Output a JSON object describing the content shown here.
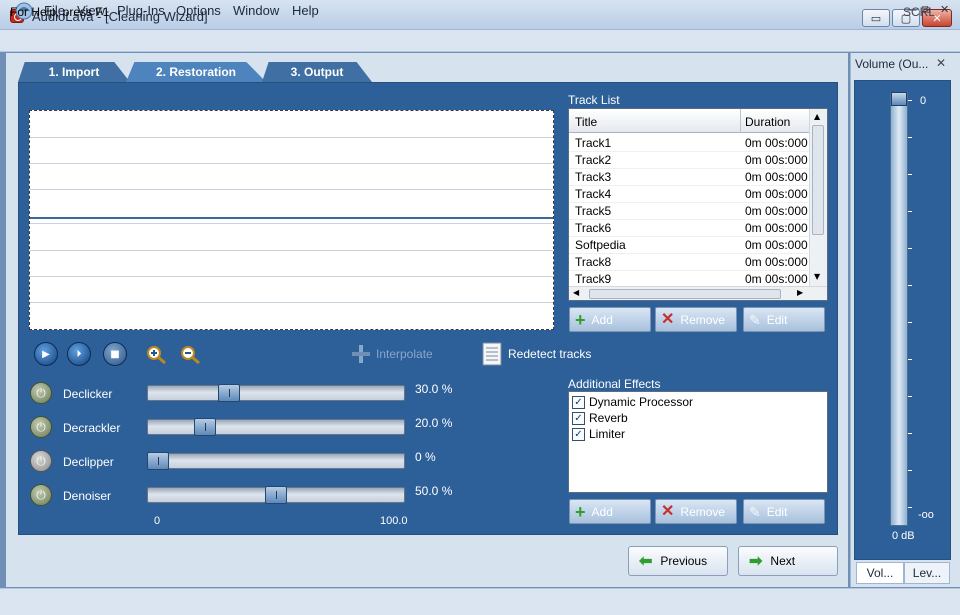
{
  "app": {
    "title": "AudioLava - [Cleaning Wizard]"
  },
  "window_controls": {
    "minimize": "▭",
    "restore": "▢",
    "close": "✕"
  },
  "menu": [
    "File",
    "View",
    "Plug-Ins",
    "Options",
    "Window",
    "Help"
  ],
  "mdi_controls": {
    "minimize": "—",
    "restore": "⧉",
    "close": "✕"
  },
  "tabs": [
    {
      "label": "1. Import",
      "active": false
    },
    {
      "label": "2. Restoration",
      "active": true
    },
    {
      "label": "3. Output",
      "active": false
    }
  ],
  "toolbar": {
    "play_icon": "play-icon",
    "play_selection_icon": "play-selection-icon",
    "stop_icon": "stop-icon",
    "zoom_in_icon": "zoom-in-icon",
    "zoom_out_icon": "zoom-out-icon",
    "interpolate_label": "Interpolate",
    "redetect_label": "Redetect tracks"
  },
  "effects": [
    {
      "name": "Declicker",
      "value_text": "30.0 %",
      "value": 30.0,
      "enabled": true
    },
    {
      "name": "Decrackler",
      "value_text": "20.0 %",
      "value": 20.0,
      "enabled": true
    },
    {
      "name": "Declipper",
      "value_text": "0 %",
      "value": 0,
      "enabled": false
    },
    {
      "name": "Denoiser",
      "value_text": "50.0 %",
      "value": 50.0,
      "enabled": true
    }
  ],
  "slider_scale": {
    "min_label": "0",
    "max_label": "100.0"
  },
  "track_list": {
    "label": "Track List",
    "columns": [
      "Title",
      "Duration"
    ],
    "rows": [
      {
        "title": "Track1",
        "duration": "0m 00s:000"
      },
      {
        "title": "Track2",
        "duration": "0m 00s:000"
      },
      {
        "title": "Track3",
        "duration": "0m 00s:000"
      },
      {
        "title": "Track4",
        "duration": "0m 00s:000"
      },
      {
        "title": "Track5",
        "duration": "0m 00s:000"
      },
      {
        "title": "Track6",
        "duration": "0m 00s:000"
      },
      {
        "title": "Softpedia",
        "duration": "0m 00s:000"
      },
      {
        "title": "Track8",
        "duration": "0m 00s:000"
      },
      {
        "title": "Track9",
        "duration": "0m 00s:000"
      }
    ],
    "buttons": {
      "add": "Add",
      "remove": "Remove",
      "edit": "Edit"
    }
  },
  "additional_effects": {
    "label": "Additional Effects",
    "items": [
      {
        "name": "Dynamic Processor",
        "checked": true
      },
      {
        "name": "Reverb",
        "checked": true
      },
      {
        "name": "Limiter",
        "checked": true
      }
    ],
    "buttons": {
      "add": "Add",
      "remove": "Remove",
      "edit": "Edit"
    }
  },
  "navigation": {
    "previous": "Previous",
    "next": "Next"
  },
  "volume_pane": {
    "title": "Volume (Ou...",
    "top_label": "0",
    "bottom_label": "-oo",
    "readout": "0 dB",
    "tabs": [
      "Vol...",
      "Lev..."
    ]
  },
  "status": {
    "text": "For Help, press F1",
    "indicator": "SCRL"
  }
}
